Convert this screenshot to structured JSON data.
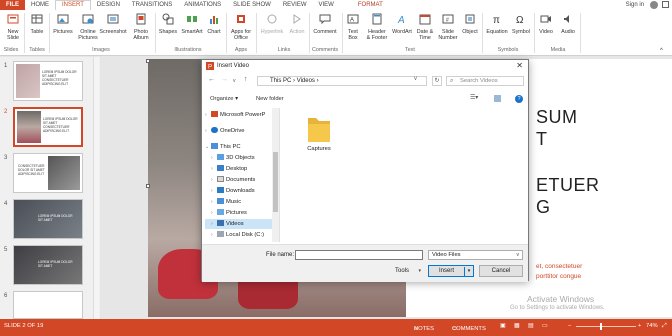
{
  "tabs": [
    "FILE",
    "HOME",
    "INSERT",
    "DESIGN",
    "TRANSITIONS",
    "ANIMATIONS",
    "SLIDE SHOW",
    "REVIEW",
    "VIEW",
    "FORMAT"
  ],
  "signin": "Sign in",
  "ribbon": {
    "buttons": [
      {
        "label": "New\nSlide",
        "icon": "new-slide-icon"
      },
      {
        "label": "Table",
        "icon": "table-icon"
      },
      {
        "label": "Pictures",
        "icon": "pictures-icon"
      },
      {
        "label": "Online\nPictures",
        "icon": "online-pictures-icon"
      },
      {
        "label": "Screenshot",
        "icon": "screenshot-icon"
      },
      {
        "label": "Photo\nAlbum",
        "icon": "photo-album-icon"
      },
      {
        "label": "Shapes",
        "icon": "shapes-icon"
      },
      {
        "label": "SmartArt",
        "icon": "smartart-icon"
      },
      {
        "label": "Chart",
        "icon": "chart-icon"
      },
      {
        "label": "Apps for\nOffice",
        "icon": "apps-icon"
      },
      {
        "label": "Hyperlink",
        "icon": "hyperlink-icon"
      },
      {
        "label": "Action",
        "icon": "action-icon"
      },
      {
        "label": "Comment",
        "icon": "comment-icon"
      },
      {
        "label": "Text\nBox",
        "icon": "text-box-icon"
      },
      {
        "label": "Header\n& Footer",
        "icon": "header-footer-icon"
      },
      {
        "label": "WordArt",
        "icon": "wordart-icon"
      },
      {
        "label": "Date &\nTime",
        "icon": "date-time-icon"
      },
      {
        "label": "Slide\nNumber",
        "icon": "slide-number-icon"
      },
      {
        "label": "Object",
        "icon": "object-icon"
      },
      {
        "label": "Equation",
        "icon": "equation-icon"
      },
      {
        "label": "Symbol",
        "icon": "symbol-icon"
      },
      {
        "label": "Video",
        "icon": "video-icon"
      },
      {
        "label": "Audio",
        "icon": "audio-icon"
      }
    ],
    "groups": [
      "Slides",
      "Tables",
      "Images",
      "Illustrations",
      "Apps",
      "Links",
      "Comments",
      "Text",
      "Symbols",
      "Media"
    ]
  },
  "thumbnails": [
    {
      "num": "1",
      "text": "LOREM IPSUM DOLOR SIT AMET CONSECTETUER ADIPISCING ELIT"
    },
    {
      "num": "2",
      "text": "LOREM IPSUM DOLOR SIT AMET CONSECTETUER ADIPISCING ELIT"
    },
    {
      "num": "3",
      "text": "CONSECTETUER DOLOR SIT AMET ADIPISCING ELIT"
    },
    {
      "num": "4",
      "text": "LOREM IPSUM DOLOR SIT AMET"
    },
    {
      "num": "5",
      "text": "LOREM IPSUM DOLOR SIT AMET"
    },
    {
      "num": "6",
      "text": ""
    }
  ],
  "slide": {
    "line1": "SUM",
    "line2": "T",
    "line3": "ETUER",
    "line4": "G",
    "red1": "et, consectetuer",
    "red2": "porttitor congue"
  },
  "dialog": {
    "title": "Insert Video",
    "close": "✕",
    "address": [
      "This PC",
      "Videos"
    ],
    "search_placeholder": "Search Videos",
    "organize": "Organize",
    "new_folder": "New folder",
    "nav": [
      {
        "label": "Microsoft PowerP",
        "icon": "powerpoint-icon",
        "expand": ">"
      },
      {
        "label": "OneDrive",
        "icon": "onedrive-icon",
        "expand": ">"
      },
      {
        "label": "This PC",
        "icon": "this-pc-icon",
        "expand": "v"
      },
      {
        "label": "3D Objects",
        "icon": "3d-objects-icon",
        "expand": ">"
      },
      {
        "label": "Desktop",
        "icon": "desktop-icon",
        "expand": ">"
      },
      {
        "label": "Documents",
        "icon": "documents-icon",
        "expand": ">"
      },
      {
        "label": "Downloads",
        "icon": "downloads-icon",
        "expand": ">"
      },
      {
        "label": "Music",
        "icon": "music-icon",
        "expand": ">"
      },
      {
        "label": "Pictures",
        "icon": "pictures-icon",
        "expand": ">"
      },
      {
        "label": "Videos",
        "icon": "videos-icon",
        "expand": ">"
      },
      {
        "label": "Local Disk (C:)",
        "icon": "disk-icon",
        "expand": ">"
      }
    ],
    "folder": "Captures",
    "file_name_label": "File name:",
    "file_name_value": "",
    "file_type": "Video Files",
    "tools": "Tools",
    "insert": "Insert",
    "cancel": "Cancel"
  },
  "status": {
    "slide": "SLIDE 2 OF 19",
    "notes": "NOTES",
    "comments": "COMMENTS",
    "zoom": "74%"
  },
  "watermark": {
    "line1": "Activate Windows",
    "line2": "Go to Settings to activate Windows."
  },
  "colors": {
    "accent": "#d24726",
    "selection": "#cce4f7",
    "folder": "#f5c84c"
  }
}
